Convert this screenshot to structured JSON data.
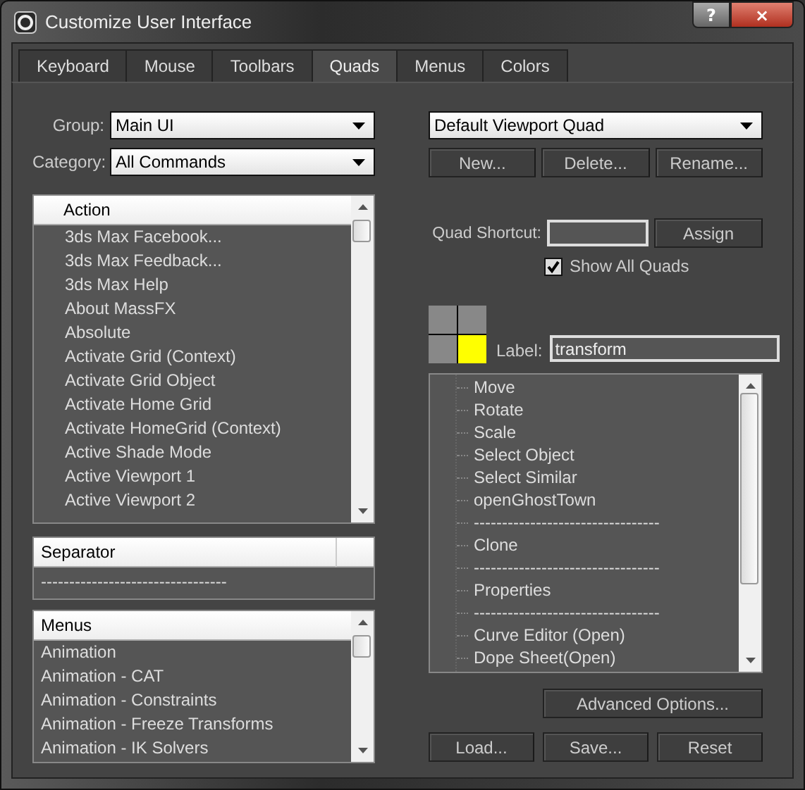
{
  "window": {
    "title": "Customize User Interface",
    "help_button": "?",
    "close_button": "×"
  },
  "tabs": [
    {
      "label": "Keyboard",
      "selected": false
    },
    {
      "label": "Mouse",
      "selected": false
    },
    {
      "label": "Toolbars",
      "selected": false
    },
    {
      "label": "Quads",
      "selected": true
    },
    {
      "label": "Menus",
      "selected": false
    },
    {
      "label": "Colors",
      "selected": false
    }
  ],
  "group": {
    "label": "Group:",
    "value": "Main UI"
  },
  "category": {
    "label": "Category:",
    "value": "All Commands"
  },
  "action_list": {
    "header": "Action",
    "items": [
      "3ds Max Facebook...",
      "3ds Max Feedback...",
      "3ds Max Help",
      "About MassFX",
      "Absolute",
      "Activate Grid (Context)",
      "Activate Grid Object",
      "Activate Home Grid",
      "Activate HomeGrid (Context)",
      "Active Shade Mode",
      "Active Viewport 1",
      "Active Viewport 2"
    ]
  },
  "separator_list": {
    "header": "Separator",
    "items": [
      "---------------------------------"
    ]
  },
  "menus_list": {
    "header": "Menus",
    "items": [
      "Animation",
      "Animation - CAT",
      "Animation - Constraints",
      "Animation - Freeze Transforms",
      "Animation - IK Solvers"
    ]
  },
  "quad_set": {
    "value": "Default Viewport Quad"
  },
  "quad_buttons": [
    "New...",
    "Delete...",
    "Rename..."
  ],
  "quad_shortcut": {
    "label": "Quad Shortcut:",
    "button": "Assign"
  },
  "show_all_quads": {
    "label": "Show All Quads",
    "checked": true
  },
  "quads": [
    {
      "selected": false
    },
    {
      "selected": false
    },
    {
      "selected": false
    },
    {
      "selected": true
    }
  ],
  "quad_label": {
    "label": "Label:",
    "value": "transform"
  },
  "quad_items": [
    "Move",
    "Rotate",
    "Scale",
    "Select Object",
    "Select Similar",
    "openGhostTown",
    "---------------------------------",
    "Clone",
    "---------------------------------",
    "Properties",
    "---------------------------------",
    "Curve Editor (Open)",
    "Dope Sheet(Open)"
  ],
  "advanced_button": "Advanced Options...",
  "bottom_buttons": [
    "Load...",
    "Save...",
    "Reset"
  ]
}
